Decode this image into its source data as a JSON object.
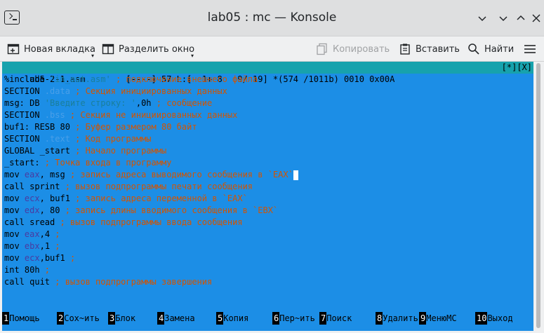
{
  "window": {
    "title": "lab05 : mc — Konsole"
  },
  "toolbar": {
    "new_tab": "Новая вкладка",
    "split": "Разделить окно",
    "copy": "Копировать",
    "paste": "Вставить",
    "find": "Найти"
  },
  "editor": {
    "status_left": "lab5-2-1.asm        [----] 57 L:[  1+ 8   9/ 19] *(574 /1011b) 0010 0x00A",
    "status_right": "[*][X]",
    "lines": {
      "l1": {
        "a": "%include ",
        "b": "'in_out.asm'",
        "c": " ; подключение внешнего файла"
      },
      "l2": {
        "a": "SECTION ",
        "b": ".data",
        "c": " ; Секция инициированных данных"
      },
      "l3": {
        "a": "msg: DB ",
        "b": "'Введите строку: '",
        "c": ",0h",
        "d": " ; сообщение"
      },
      "l4": {
        "a": "SECTION ",
        "b": ".bss",
        "c": " ; Секция не инициированных данных"
      },
      "l5": {
        "a": "buf1: RESB 80",
        "c": " ; Буфер размером 80 байт"
      },
      "l6": {
        "a": "SECTION ",
        "b": ".text",
        "c": " ; Код программы"
      },
      "l7": {
        "a": "GLOBAL _start",
        "c": " ; Начало программы"
      },
      "l8": {
        "a": "_start:",
        "c": " ; Точка входа в программу"
      },
      "l9": {
        "a": "mov ",
        "r": "eax",
        "b": ", msg",
        "c": " ; запись адреса выводимого сообщения в `EAX`"
      },
      "l10": {
        "a": "call sprint",
        "c": " ; вызов подпрограммы печати сообщения"
      },
      "l11": {
        "a": "mov ",
        "r": "ecx",
        "b": ", buf1",
        "c": " ; запись адреса переменной в `EAX`"
      },
      "l12": {
        "a": "mov ",
        "r": "edx",
        "b": ", 80",
        "c": " ; запись длины вводимого сообщения в `EBX`"
      },
      "l13": {
        "a": "call sread",
        "c": " ; вызов подпрограммы ввода сообщения"
      },
      "l14": {
        "a": "mov ",
        "r": "eax",
        "b": ",4",
        "c": " ;"
      },
      "l15": {
        "a": "mov ",
        "r": "ebx",
        "b": ",1",
        "c": " ;"
      },
      "l16": {
        "a": "mov ",
        "r": "ecx",
        "b": ",buf1",
        "c": " ;"
      },
      "l17": {
        "a": "int 80h",
        "c": " ;"
      },
      "l18": {
        "a": "call quit",
        "c": " ; вызов подпрограммы завершения"
      }
    }
  },
  "fkeys": [
    {
      "num": "1",
      "label": "Помощь"
    },
    {
      "num": "2",
      "label": "Сох~ить"
    },
    {
      "num": "3",
      "label": "Блок"
    },
    {
      "num": "4",
      "label": "Замена"
    },
    {
      "num": "5",
      "label": "Копия"
    },
    {
      "num": "6",
      "label": "Пер~ить"
    },
    {
      "num": "7",
      "label": "Поиск"
    },
    {
      "num": "8",
      "label": "Удалить"
    },
    {
      "num": "9",
      "label": "МенюMC"
    },
    {
      "num": "10",
      "label": "Выход"
    }
  ],
  "colors": {
    "editor_bg": "#1c8ee6",
    "status_bg": "#17a2ad",
    "comment": "#d35400",
    "string": "#1a7f9a",
    "register": "#4a3ba0"
  }
}
